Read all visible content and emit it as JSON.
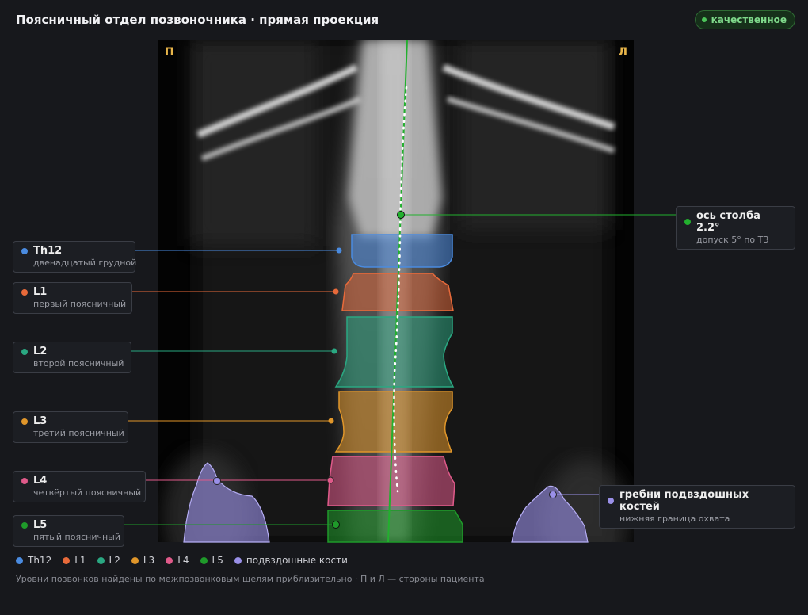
{
  "header": {
    "title": "Поясничный отдел позвоночника · прямая проекция",
    "badge": "качественное"
  },
  "viewer": {
    "right_marker": "П",
    "left_marker": "Л"
  },
  "colors": {
    "th12": "#4a8be0",
    "l1": "#e86a3a",
    "l2": "#2aa882",
    "l3": "#e0962a",
    "l4": "#e05a8a",
    "l5": "#1f9a2a",
    "iliac": "#9a90e8",
    "axis": "#22b02e"
  },
  "callouts": {
    "th12": {
      "name": "Th12",
      "desc": "двенадцатый грудной"
    },
    "l1": {
      "name": "L1",
      "desc": "первый поясничный"
    },
    "l2": {
      "name": "L2",
      "desc": "второй поясничный"
    },
    "l3": {
      "name": "L3",
      "desc": "третий поясничный"
    },
    "l4": {
      "name": "L4",
      "desc": "четвёртый поясничный"
    },
    "l5": {
      "name": "L5",
      "desc": "пятый поясничный"
    },
    "axis": {
      "name": "ось столба 2.2°",
      "desc": "допуск 5° по ТЗ"
    },
    "iliac": {
      "name": "гребни подвздошных костей",
      "desc": "нижняя граница охвата"
    }
  },
  "legend": {
    "th12": "Th12",
    "l1": "L1",
    "l2": "L2",
    "l3": "L3",
    "l4": "L4",
    "l5": "L5",
    "iliac": "подвздошные кости"
  },
  "footnote": "Уровни позвонков найдены по межпозвонковым щелям приблизительно · П и Л — стороны пациента"
}
